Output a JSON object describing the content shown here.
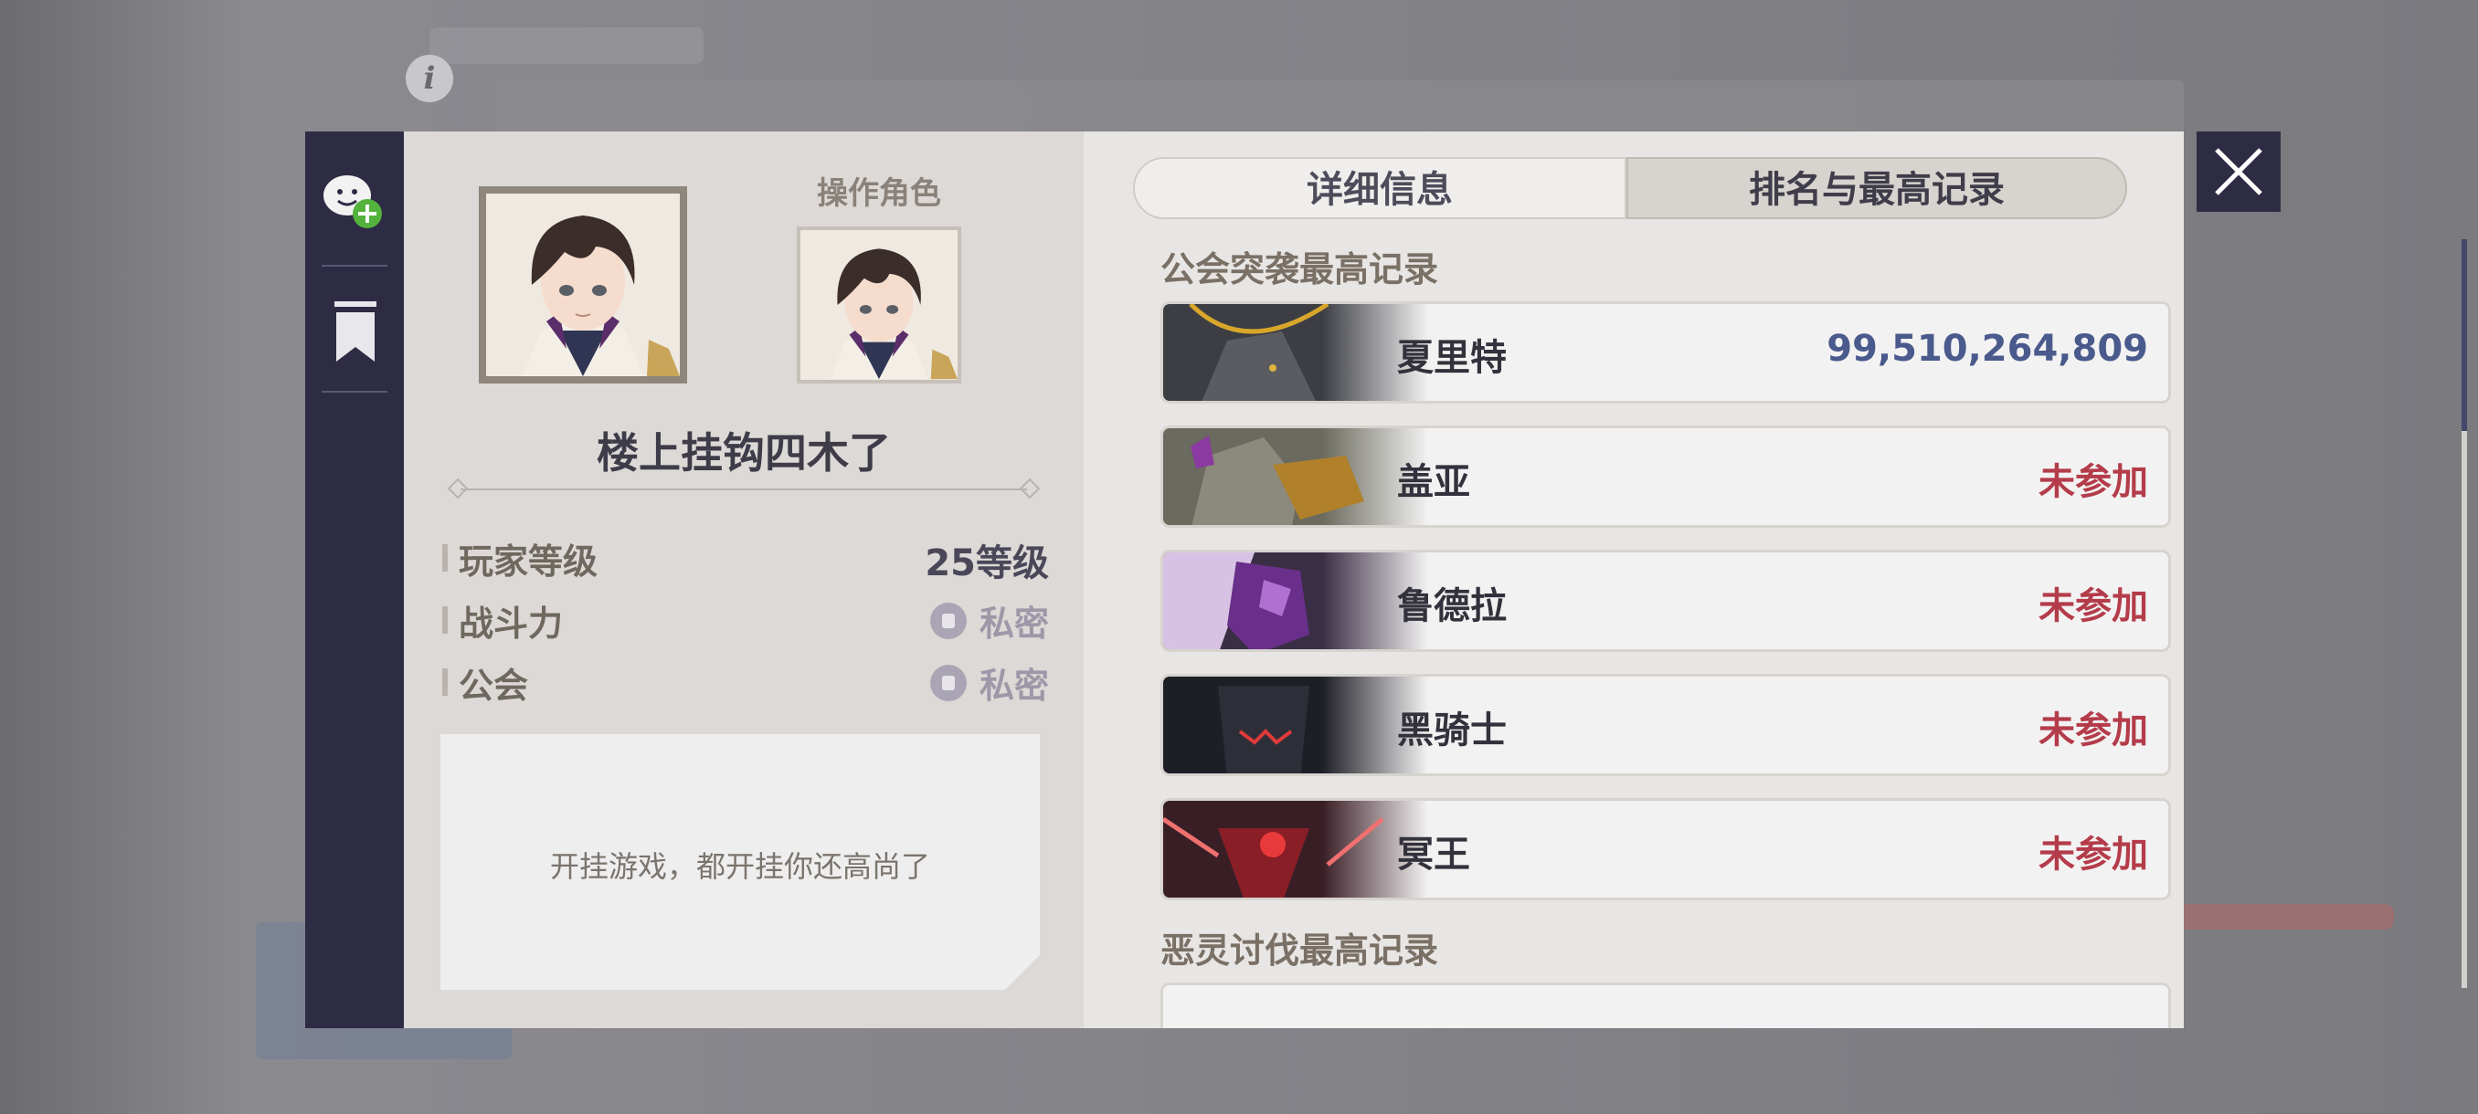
{
  "window": {
    "info_icon": "info-icon",
    "close_icon": "close-icon"
  },
  "sidebar": {
    "icons": [
      "add-friend-icon",
      "bookmark-icon"
    ]
  },
  "profile": {
    "operate_character_label": "操作角色",
    "player_name": "楼上挂钩四木了",
    "stats": [
      {
        "label": "玩家等级",
        "value": "25等级"
      },
      {
        "label": "战斗力",
        "value": "私密"
      },
      {
        "label": "公会",
        "value": "私密"
      }
    ],
    "bio": "开挂游戏，都开挂你还高尚了"
  },
  "tabs": [
    {
      "label": "详细信息",
      "active": false
    },
    {
      "label": "排名与最高记录",
      "active": true
    }
  ],
  "guild_raid": {
    "title": "公会突袭最高记录",
    "bosses": [
      {
        "name": "夏里特",
        "value": "99,510,264,809",
        "kind": "score"
      },
      {
        "name": "盖亚",
        "value": "未参加",
        "kind": "absent"
      },
      {
        "name": "鲁德拉",
        "value": "未参加",
        "kind": "absent"
      },
      {
        "name": "黑骑士",
        "value": "未参加",
        "kind": "absent"
      },
      {
        "name": "冥王",
        "value": "未参加",
        "kind": "absent"
      }
    ]
  },
  "ghost_hunt": {
    "title": "恶灵讨伐最高记录"
  },
  "colors": {
    "navy": "#2e2b44",
    "score": "#4a5a8c",
    "absent": "#b43c4a"
  }
}
